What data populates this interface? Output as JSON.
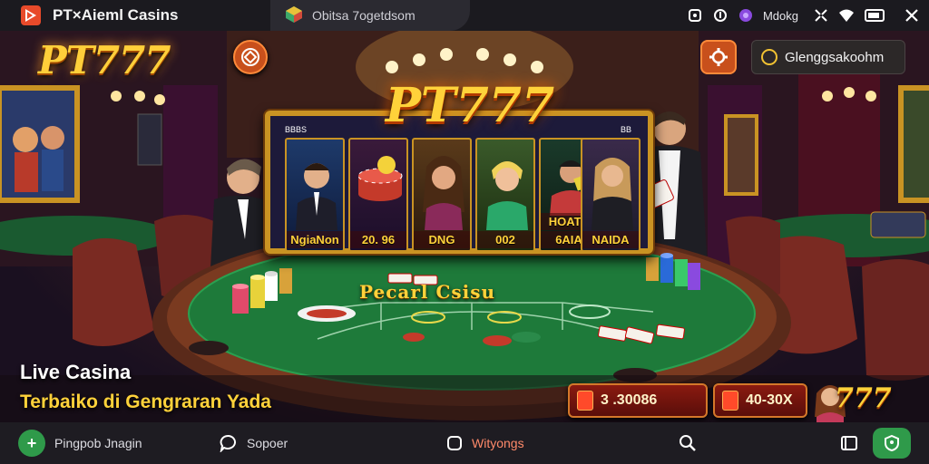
{
  "status_bar": {
    "app_title": "PT×Aieml Casins",
    "tab_text": "Obitsa 7ogetdsom",
    "status_label": "Mdokg"
  },
  "header": {
    "brand_logo": "PT777",
    "account_label": "Glenggsakoohm"
  },
  "game": {
    "center_logo": "PT777",
    "slot_corner_left": "BBBS",
    "slot_corner_right": "BB",
    "reels": [
      {
        "label": "NgiaNon"
      },
      {
        "label": "20. 96"
      },
      {
        "label": "DNG"
      },
      {
        "label": "002"
      },
      {
        "label": "6AIA"
      },
      {
        "label": "NAIDA"
      }
    ],
    "reel_extra_label": "HOATV",
    "table_title": "Pecarl Csisu"
  },
  "hero": {
    "title": "Live Casina",
    "subtitle": "Terbaiko di Gengraran Yada"
  },
  "jackpots": [
    {
      "value": "3 .30086"
    },
    {
      "value": "40-30X"
    }
  ],
  "mini_logo": "777",
  "bottom_nav": {
    "items": [
      {
        "label": "Pingpob Jnagin"
      },
      {
        "label": "Sopoer"
      },
      {
        "label": "Wityongs"
      }
    ]
  },
  "colors": {
    "accent_gold": "#ffd23a",
    "felt_green": "#1e7a3a",
    "button_orange": "#c8501c",
    "nav_green": "#2f9a4a"
  },
  "icons": [
    "app-logo-icon",
    "app-tab-icon",
    "link-icon",
    "record-icon",
    "circle-purple-icon",
    "expand-icon",
    "wifi-icon",
    "battery-icon",
    "close-icon",
    "chip-icon",
    "settings-icon",
    "plus-icon",
    "chat-icon",
    "square-icon",
    "search-icon",
    "cast-icon",
    "shield-icon"
  ]
}
